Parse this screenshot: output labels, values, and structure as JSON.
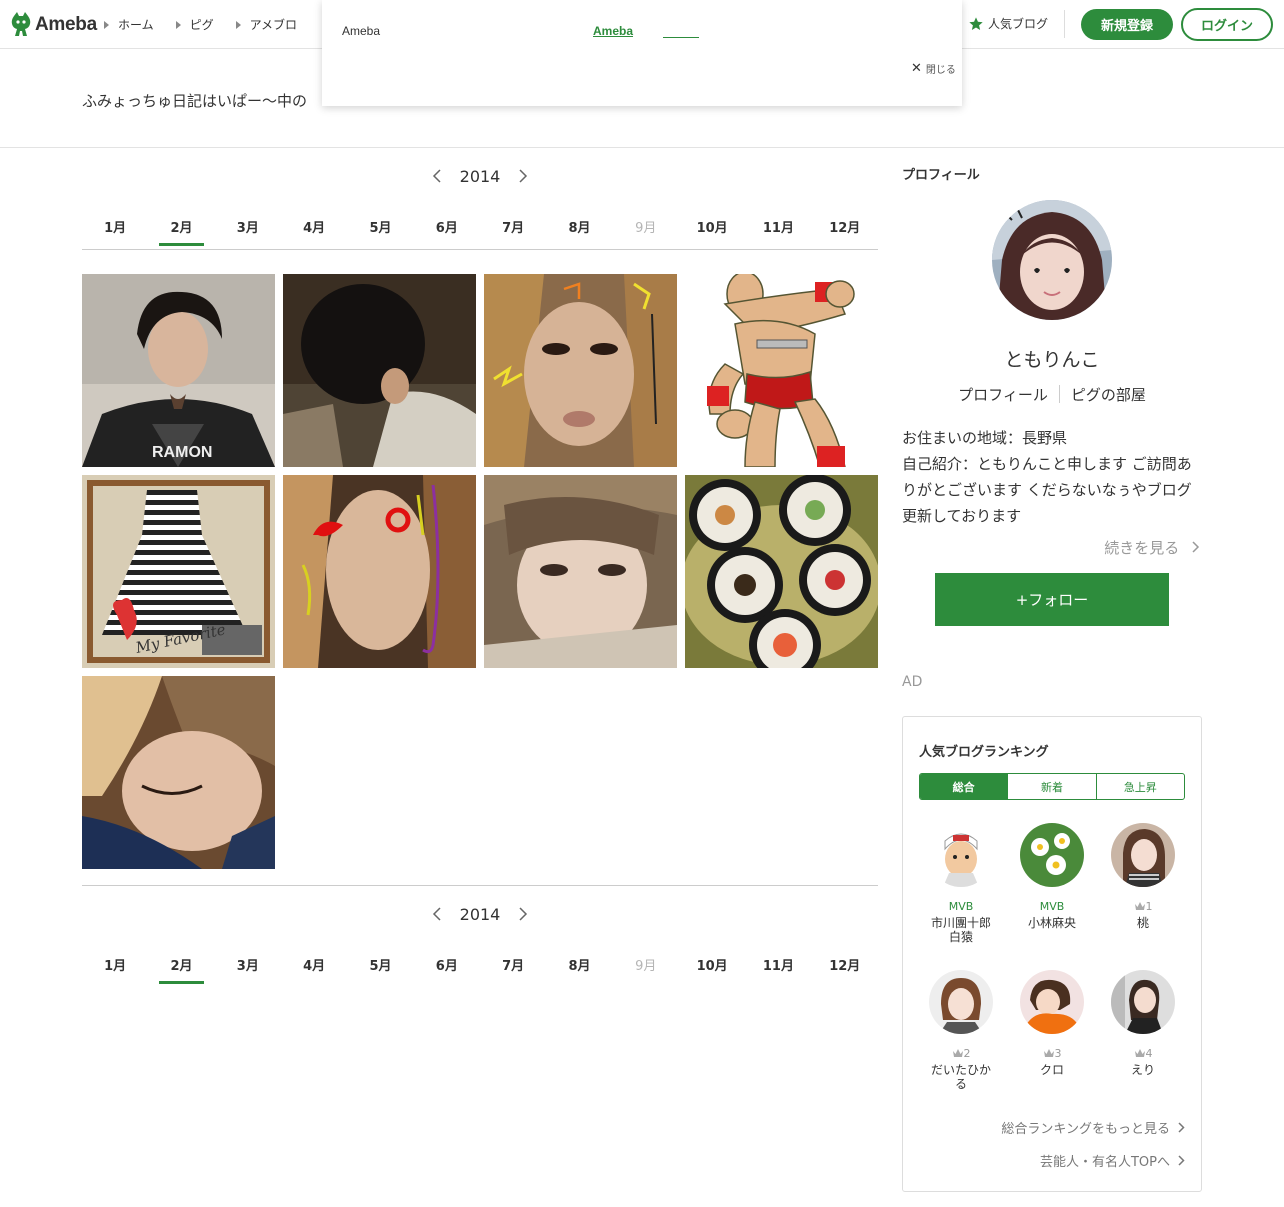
{
  "header": {
    "logo_text": "Ameba",
    "nav": [
      "ホーム",
      "ピグ",
      "アメブロ"
    ],
    "popular_blog": "人気ブログ",
    "signup_label": "新規登録",
    "login_label": "ログイン"
  },
  "popup": {
    "left_text": "Ameba",
    "link_text": "Ameba",
    "close_label": "閉じる"
  },
  "blog": {
    "title": "ふみょっちゅ日記はいぱー〜中の"
  },
  "archive": {
    "year": "2014",
    "months": [
      {
        "label": "1月",
        "state": "normal"
      },
      {
        "label": "2月",
        "state": "active"
      },
      {
        "label": "3月",
        "state": "normal"
      },
      {
        "label": "4月",
        "state": "normal"
      },
      {
        "label": "5月",
        "state": "normal"
      },
      {
        "label": "6月",
        "state": "normal"
      },
      {
        "label": "7月",
        "state": "normal"
      },
      {
        "label": "8月",
        "state": "normal"
      },
      {
        "label": "9月",
        "state": "disabled"
      },
      {
        "label": "10月",
        "state": "normal"
      },
      {
        "label": "11月",
        "state": "normal"
      },
      {
        "label": "12月",
        "state": "normal"
      }
    ],
    "image_overlay_texts": [
      "RAMON",
      "My Favorite"
    ]
  },
  "sidebar": {
    "heading": "プロフィール",
    "nickname": "ともりんこ",
    "profile_link": "プロフィール",
    "pig_link": "ピグの部屋",
    "location": "お住まいの地域：長野県",
    "intro": "自己紹介：ともりんこと申します ご訪問ありがとございます くだらないなぅやブログ更新しております",
    "more_label": "続きを見る",
    "follow_label": "+フォロー",
    "ad_label": "AD"
  },
  "ranking": {
    "title": "人気ブログランキング",
    "tabs": [
      "総合",
      "新着",
      "急上昇"
    ],
    "items": [
      {
        "badge": "MVB",
        "name": "市川團十郎\n白猿"
      },
      {
        "badge": "MVB",
        "name": "小林麻央"
      },
      {
        "badge": "1",
        "name": "桃"
      },
      {
        "badge": "2",
        "name": "だいたひか\nる"
      },
      {
        "badge": "3",
        "name": "クロ"
      },
      {
        "badge": "4",
        "name": "えり"
      }
    ],
    "more_overall": "総合ランキングをもっと見る",
    "celebrity_top": "芸能人・有名人TOPへ"
  },
  "colors": {
    "accent": "#2d8c3c",
    "border": "#dddddd",
    "muted": "#999999"
  }
}
